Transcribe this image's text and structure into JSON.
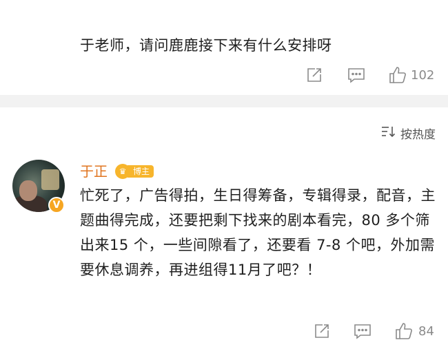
{
  "top_comment": {
    "text": "于老师，请问鹿鹿接下来有什么安排呀",
    "like_count": "102"
  },
  "sort": {
    "label": "按热度"
  },
  "reply": {
    "username": "于正",
    "badge_label": "博主",
    "verified_mark": "V",
    "text": "忙死了，广告得拍，生日得筹备，专辑得录，配音，主题曲得完成，还要把剩下找来的剧本看完，80 多个筛出来15 个，一些间隙看了，还要看 7-8 个吧，外加需要休息调养，再进组得11月了吧？！",
    "like_count": "84"
  },
  "icons": {
    "share": "share-icon",
    "comment": "comment-icon",
    "like": "thumbs-up-icon",
    "sort": "sort-icon",
    "verified": "verified-badge-icon",
    "crown": "crown-icon"
  },
  "colors": {
    "username": "#e0741f",
    "badge": "#f7b52c",
    "verified": "#f6a623",
    "icon_gray": "#8a8a8a",
    "divider": "#f2f2f2"
  }
}
